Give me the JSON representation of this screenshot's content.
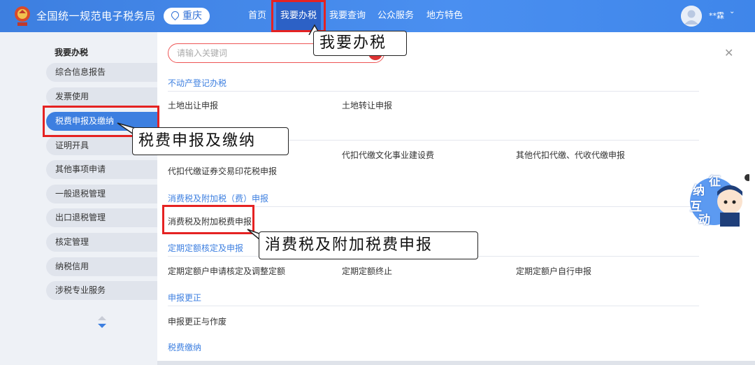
{
  "header": {
    "site_title": "全国统一规范电子税务局",
    "city": "重庆",
    "nav": [
      "首页",
      "我要办税",
      "我要查询",
      "公众服务",
      "地方特色"
    ],
    "user_name": "**霖"
  },
  "sidebar": {
    "title": "我要办税",
    "items": [
      "综合信息报告",
      "发票使用",
      "税费申报及缴纳",
      "证明开具",
      "其他事项申请",
      "一般退税管理",
      "出口退税管理",
      "核定管理",
      "纳税信用",
      "涉税专业服务"
    ]
  },
  "search": {
    "placeholder": "请输入关键词"
  },
  "sections": {
    "real_estate": {
      "title": "不动产登记办税",
      "links": [
        "土地出让申报",
        "土地转让申报"
      ]
    },
    "withholding": {
      "links": [
        "代扣代缴文化事业建设费",
        "其他代扣代缴、代收代缴申报",
        "代扣代缴证券交易印花税申报"
      ]
    },
    "consumption": {
      "title": "消费税及附加税（费）申报",
      "links": [
        "消费税及附加税费申报"
      ]
    },
    "fixed_quota": {
      "title": "定期定额核定及申报",
      "links": [
        "定期定额户申请核定及调整定额",
        "定期定额终止",
        "定期定额户自行申报"
      ]
    },
    "correction": {
      "title": "申报更正",
      "links": [
        "申报更正与作废"
      ]
    },
    "payment": {
      "title": "税费缴纳"
    }
  },
  "callouts": {
    "nav": "我要办税",
    "sidebar": "税费申报及缴纳",
    "link": "消费税及附加税费申报"
  },
  "float_badge": {
    "chars": [
      "征",
      "纳",
      "互",
      "动"
    ]
  },
  "colors": {
    "brand_blue": "#3d7fe0",
    "highlight_red": "#e52222"
  }
}
